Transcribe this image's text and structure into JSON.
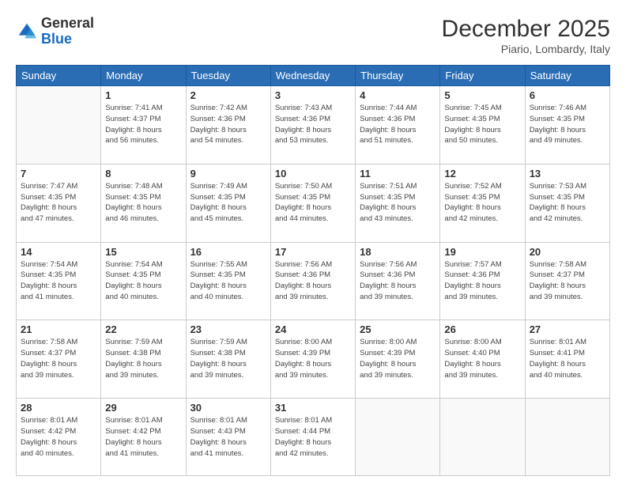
{
  "logo": {
    "general": "General",
    "blue": "Blue"
  },
  "header": {
    "month": "December 2025",
    "location": "Piario, Lombardy, Italy"
  },
  "weekdays": [
    "Sunday",
    "Monday",
    "Tuesday",
    "Wednesday",
    "Thursday",
    "Friday",
    "Saturday"
  ],
  "weeks": [
    [
      {
        "day": "",
        "sunrise": "",
        "sunset": "",
        "daylight": ""
      },
      {
        "day": "1",
        "sunrise": "Sunrise: 7:41 AM",
        "sunset": "Sunset: 4:37 PM",
        "daylight": "Daylight: 8 hours and 56 minutes."
      },
      {
        "day": "2",
        "sunrise": "Sunrise: 7:42 AM",
        "sunset": "Sunset: 4:36 PM",
        "daylight": "Daylight: 8 hours and 54 minutes."
      },
      {
        "day": "3",
        "sunrise": "Sunrise: 7:43 AM",
        "sunset": "Sunset: 4:36 PM",
        "daylight": "Daylight: 8 hours and 53 minutes."
      },
      {
        "day": "4",
        "sunrise": "Sunrise: 7:44 AM",
        "sunset": "Sunset: 4:36 PM",
        "daylight": "Daylight: 8 hours and 51 minutes."
      },
      {
        "day": "5",
        "sunrise": "Sunrise: 7:45 AM",
        "sunset": "Sunset: 4:35 PM",
        "daylight": "Daylight: 8 hours and 50 minutes."
      },
      {
        "day": "6",
        "sunrise": "Sunrise: 7:46 AM",
        "sunset": "Sunset: 4:35 PM",
        "daylight": "Daylight: 8 hours and 49 minutes."
      }
    ],
    [
      {
        "day": "7",
        "sunrise": "Sunrise: 7:47 AM",
        "sunset": "Sunset: 4:35 PM",
        "daylight": "Daylight: 8 hours and 47 minutes."
      },
      {
        "day": "8",
        "sunrise": "Sunrise: 7:48 AM",
        "sunset": "Sunset: 4:35 PM",
        "daylight": "Daylight: 8 hours and 46 minutes."
      },
      {
        "day": "9",
        "sunrise": "Sunrise: 7:49 AM",
        "sunset": "Sunset: 4:35 PM",
        "daylight": "Daylight: 8 hours and 45 minutes."
      },
      {
        "day": "10",
        "sunrise": "Sunrise: 7:50 AM",
        "sunset": "Sunset: 4:35 PM",
        "daylight": "Daylight: 8 hours and 44 minutes."
      },
      {
        "day": "11",
        "sunrise": "Sunrise: 7:51 AM",
        "sunset": "Sunset: 4:35 PM",
        "daylight": "Daylight: 8 hours and 43 minutes."
      },
      {
        "day": "12",
        "sunrise": "Sunrise: 7:52 AM",
        "sunset": "Sunset: 4:35 PM",
        "daylight": "Daylight: 8 hours and 42 minutes."
      },
      {
        "day": "13",
        "sunrise": "Sunrise: 7:53 AM",
        "sunset": "Sunset: 4:35 PM",
        "daylight": "Daylight: 8 hours and 42 minutes."
      }
    ],
    [
      {
        "day": "14",
        "sunrise": "Sunrise: 7:54 AM",
        "sunset": "Sunset: 4:35 PM",
        "daylight": "Daylight: 8 hours and 41 minutes."
      },
      {
        "day": "15",
        "sunrise": "Sunrise: 7:54 AM",
        "sunset": "Sunset: 4:35 PM",
        "daylight": "Daylight: 8 hours and 40 minutes."
      },
      {
        "day": "16",
        "sunrise": "Sunrise: 7:55 AM",
        "sunset": "Sunset: 4:35 PM",
        "daylight": "Daylight: 8 hours and 40 minutes."
      },
      {
        "day": "17",
        "sunrise": "Sunrise: 7:56 AM",
        "sunset": "Sunset: 4:36 PM",
        "daylight": "Daylight: 8 hours and 39 minutes."
      },
      {
        "day": "18",
        "sunrise": "Sunrise: 7:56 AM",
        "sunset": "Sunset: 4:36 PM",
        "daylight": "Daylight: 8 hours and 39 minutes."
      },
      {
        "day": "19",
        "sunrise": "Sunrise: 7:57 AM",
        "sunset": "Sunset: 4:36 PM",
        "daylight": "Daylight: 8 hours and 39 minutes."
      },
      {
        "day": "20",
        "sunrise": "Sunrise: 7:58 AM",
        "sunset": "Sunset: 4:37 PM",
        "daylight": "Daylight: 8 hours and 39 minutes."
      }
    ],
    [
      {
        "day": "21",
        "sunrise": "Sunrise: 7:58 AM",
        "sunset": "Sunset: 4:37 PM",
        "daylight": "Daylight: 8 hours and 39 minutes."
      },
      {
        "day": "22",
        "sunrise": "Sunrise: 7:59 AM",
        "sunset": "Sunset: 4:38 PM",
        "daylight": "Daylight: 8 hours and 39 minutes."
      },
      {
        "day": "23",
        "sunrise": "Sunrise: 7:59 AM",
        "sunset": "Sunset: 4:38 PM",
        "daylight": "Daylight: 8 hours and 39 minutes."
      },
      {
        "day": "24",
        "sunrise": "Sunrise: 8:00 AM",
        "sunset": "Sunset: 4:39 PM",
        "daylight": "Daylight: 8 hours and 39 minutes."
      },
      {
        "day": "25",
        "sunrise": "Sunrise: 8:00 AM",
        "sunset": "Sunset: 4:39 PM",
        "daylight": "Daylight: 8 hours and 39 minutes."
      },
      {
        "day": "26",
        "sunrise": "Sunrise: 8:00 AM",
        "sunset": "Sunset: 4:40 PM",
        "daylight": "Daylight: 8 hours and 39 minutes."
      },
      {
        "day": "27",
        "sunrise": "Sunrise: 8:01 AM",
        "sunset": "Sunset: 4:41 PM",
        "daylight": "Daylight: 8 hours and 40 minutes."
      }
    ],
    [
      {
        "day": "28",
        "sunrise": "Sunrise: 8:01 AM",
        "sunset": "Sunset: 4:42 PM",
        "daylight": "Daylight: 8 hours and 40 minutes."
      },
      {
        "day": "29",
        "sunrise": "Sunrise: 8:01 AM",
        "sunset": "Sunset: 4:42 PM",
        "daylight": "Daylight: 8 hours and 41 minutes."
      },
      {
        "day": "30",
        "sunrise": "Sunrise: 8:01 AM",
        "sunset": "Sunset: 4:43 PM",
        "daylight": "Daylight: 8 hours and 41 minutes."
      },
      {
        "day": "31",
        "sunrise": "Sunrise: 8:01 AM",
        "sunset": "Sunset: 4:44 PM",
        "daylight": "Daylight: 8 hours and 42 minutes."
      },
      {
        "day": "",
        "sunrise": "",
        "sunset": "",
        "daylight": ""
      },
      {
        "day": "",
        "sunrise": "",
        "sunset": "",
        "daylight": ""
      },
      {
        "day": "",
        "sunrise": "",
        "sunset": "",
        "daylight": ""
      }
    ]
  ]
}
